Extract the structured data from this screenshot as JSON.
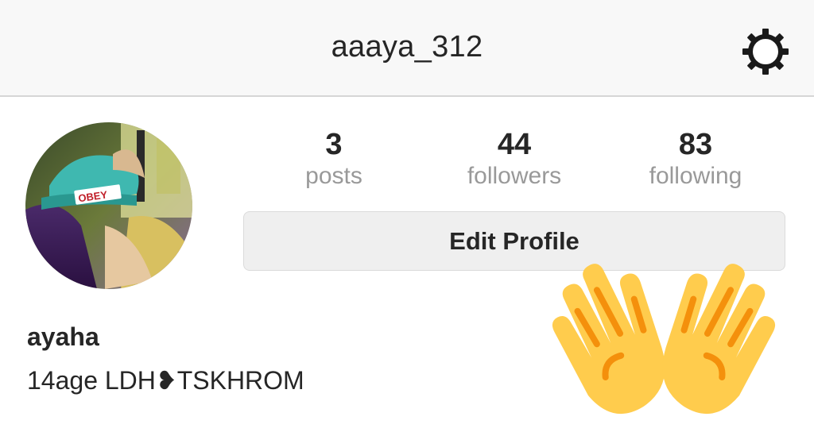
{
  "header": {
    "username": "aaaya_312",
    "settings_icon": "gear-icon"
  },
  "profile": {
    "avatar_hat_text": "OBEY",
    "stats": [
      {
        "count": "3",
        "label": "posts"
      },
      {
        "count": "44",
        "label": "followers"
      },
      {
        "count": "83",
        "label": "following"
      }
    ],
    "edit_button_label": "Edit Profile",
    "full_name": "ayaha",
    "bio": "14age LDH❥TSKHROM"
  },
  "decoration": {
    "emoji": "raised-hands-icon"
  },
  "colors": {
    "header_bg": "#f8f8f8",
    "text": "#262626",
    "muted": "#999999",
    "button_bg": "#efefef",
    "emoji_yellow": "#ffcc4d",
    "emoji_orange": "#f4900c"
  }
}
